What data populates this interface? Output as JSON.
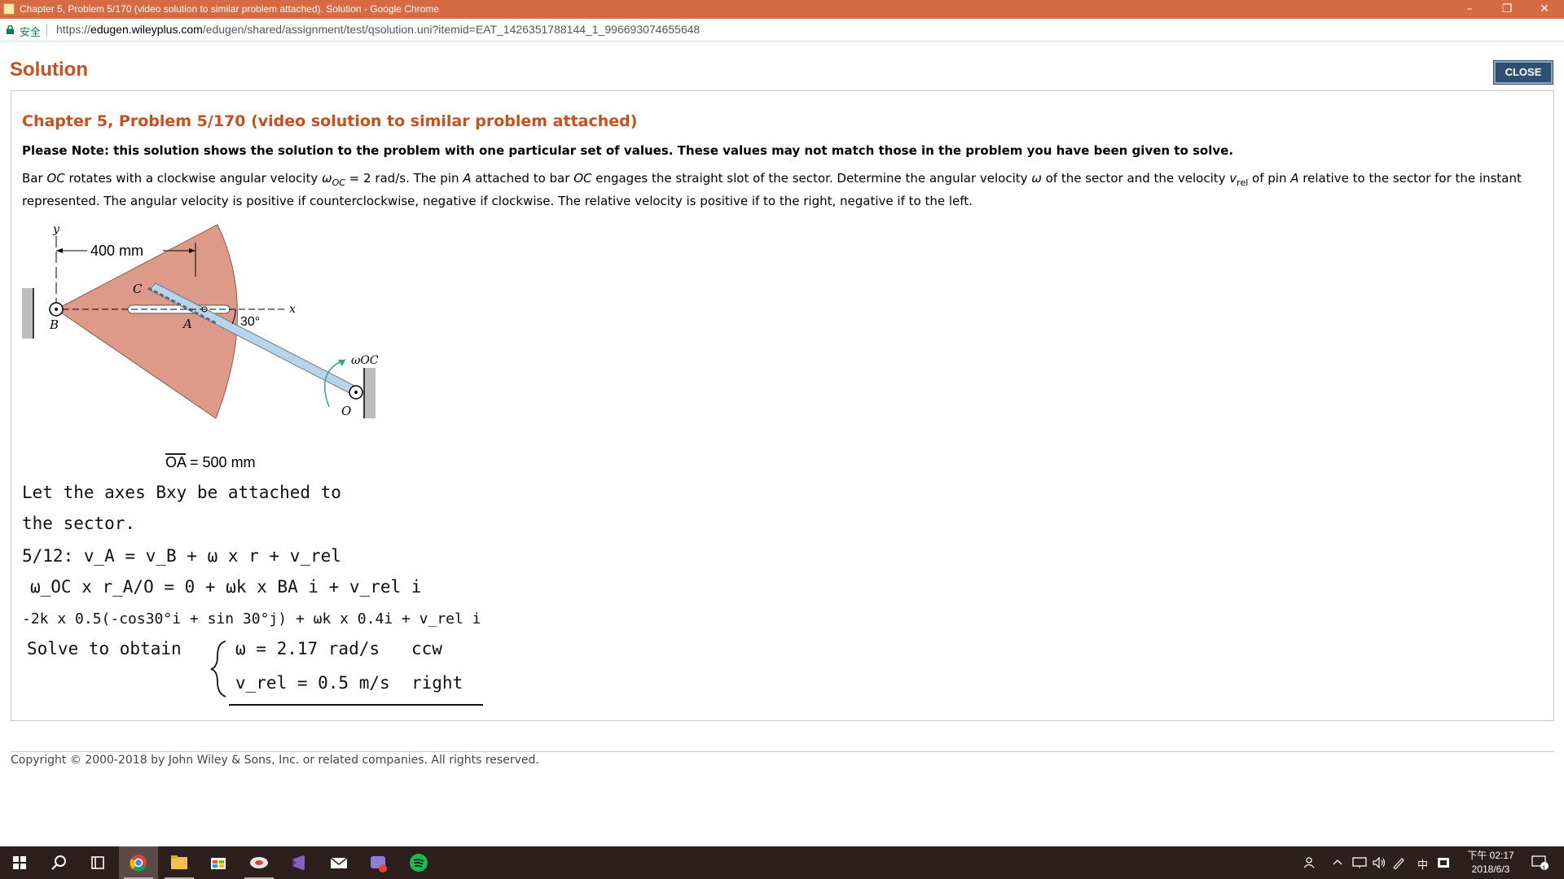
{
  "window": {
    "title": "Chapter 5, Problem 5/170 (video solution to similar problem attached). Solution - Google Chrome",
    "minimize": "–",
    "restore": "❐",
    "close": "✕"
  },
  "address": {
    "secure_label": "安全",
    "url_scheme": "https://",
    "url_host": "edugen.wileyplus.com",
    "url_path": "/edugen/shared/assignment/test/qsolution.uni?itemid=EAT_1426351788144_1_996693074655648"
  },
  "page": {
    "heading": "Solution",
    "close_label": "CLOSE",
    "problem_title": "Chapter 5, Problem 5/170 (video solution to similar problem attached)",
    "note": "Please Note: this solution shows the solution to the problem with one particular set of values. These values may not match those in the problem you have been given to solve.",
    "statement": {
      "s1": "Bar ",
      "oc1": "OC",
      "s2": " rotates with a clockwise angular velocity ",
      "omega": "ω",
      "oc_sub": "OC",
      "s3": " = 2 rad/s. The pin ",
      "a1": "A",
      "s4": " attached to bar ",
      "oc2": "OC",
      "s5": " engages the straight slot of the sector. Determine the angular velocity ",
      "omega2": "ω",
      "s6": " of the sector and the velocity ",
      "v": "v",
      "rel": "rel",
      "s7": " of pin ",
      "a2": "A",
      "s8": " relative to the sector for the instant represented. The angular velocity is positive if counterclockwise, negative if clockwise. The relative velocity is positive if to the right, negative if to the left."
    },
    "figure": {
      "dim_400": "400 mm",
      "label_y": "y",
      "label_x": "x",
      "label_c": "C",
      "label_a": "A",
      "label_b": "B",
      "label_o": "O",
      "angle": "30°",
      "omega_oc": "ωOC",
      "oa": "OA",
      "oa_value": " = 500 mm"
    },
    "handwork": {
      "line1": "Let the axes Bxy be attached to",
      "line2": "the sector.",
      "line3": "5/12:  v_A = v_B + ω x r + v_rel",
      "line4": "ω_OC x r_A/O = 0 + ωk x BA i + v_rel i",
      "line5": "-2k x 0.5(-cos30°i + sin 30°j) + ωk x 0.4i + v_rel i",
      "solve": "Solve to obtain",
      "res1": "ω = 2.17 rad/s",
      "res1_dir": "ccw",
      "res2": "v_rel = 0.5 m/s",
      "res2_dir": "right"
    },
    "copyright": "Copyright © 2000-2018 by John Wiley & Sons, Inc. or related companies. All rights reserved."
  },
  "taskbar": {
    "items": [
      "start-icon",
      "search-icon",
      "task-view-icon",
      "chrome-icon",
      "file-explorer-icon",
      "store-icon",
      "app-icon",
      "visual-studio-icon",
      "mail-icon",
      "game-icon",
      "spotify-icon"
    ],
    "tray_ime": "中",
    "time": "下午 02:17",
    "date": "2018/6/3",
    "notif_count": "1"
  },
  "colors": {
    "titlebar": "#d66a42",
    "accent": "#c8501e",
    "close_button": "#2f4f73",
    "sector": "#dd9a88",
    "bar": "#b9d4ea",
    "taskbar": "#2d1f1d"
  }
}
